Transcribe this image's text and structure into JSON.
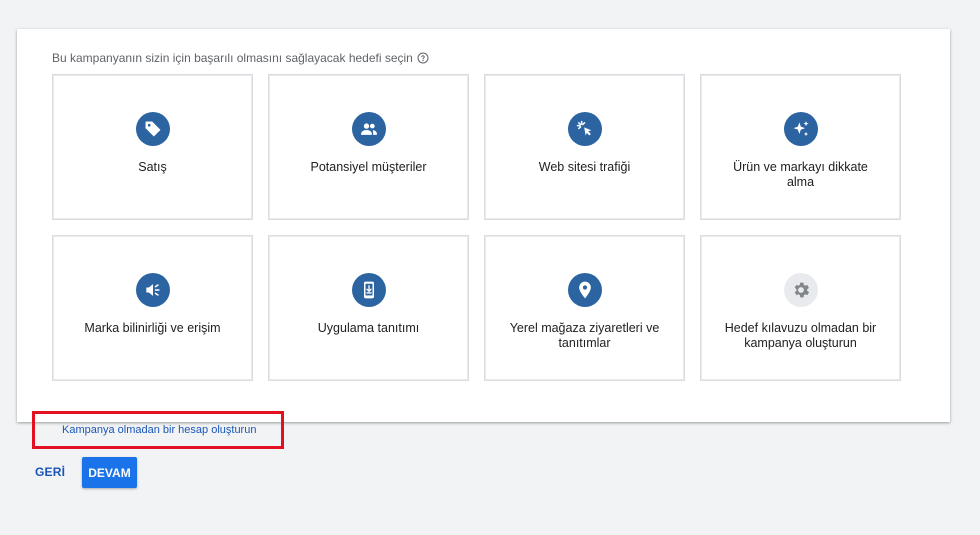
{
  "prompt": {
    "text": "Bu kampanyanın sizin için başarılı olmasını sağlayacak hedefi seçin",
    "icon": "help-circle-icon"
  },
  "goals": [
    {
      "label": "Satış",
      "icon": "tag-icon"
    },
    {
      "label": "Potansiyel müşteriler",
      "icon": "people-icon"
    },
    {
      "label": "Web sitesi trafiği",
      "icon": "cursor-click-icon"
    },
    {
      "label": "Ürün ve markayı dikkate alma",
      "icon": "sparkle-icon"
    },
    {
      "label": "Marka bilinirliği ve erişim",
      "icon": "megaphone-icon"
    },
    {
      "label": "Uygulama tanıtımı",
      "icon": "phone-download-icon"
    },
    {
      "label": "Yerel mağaza ziyaretleri ve tanıtımlar",
      "icon": "location-pin-icon"
    },
    {
      "label": "Hedef kılavuzu olmadan bir kampanya oluşturun",
      "icon": "gear-icon"
    }
  ],
  "account_link": "Kampanya olmadan bir hesap oluşturun",
  "nav": {
    "back": "GERİ",
    "next": "DEVAM"
  },
  "colors": {
    "icon_circle": "#2b64a0",
    "primary_button": "#1a73e8",
    "link": "#1a56b8",
    "highlight_border": "#e3101f"
  }
}
